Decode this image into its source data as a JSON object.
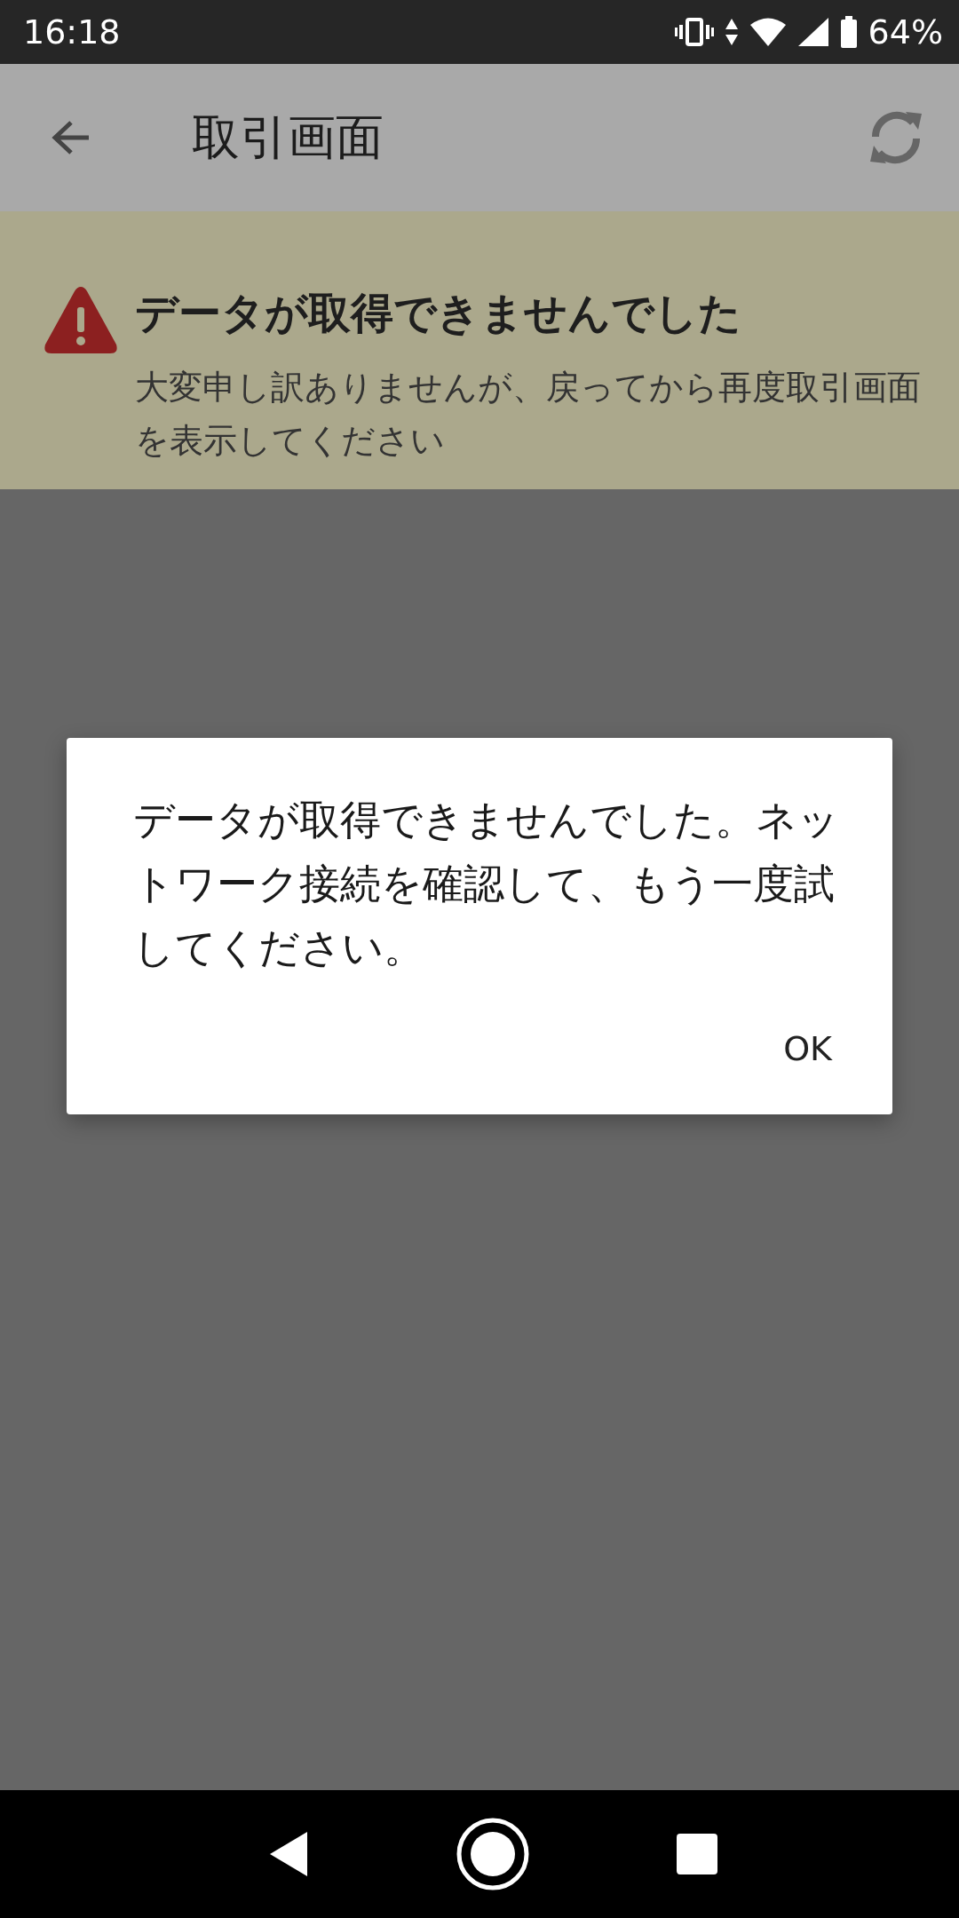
{
  "status_bar": {
    "time": "16:18",
    "battery": "64%"
  },
  "app_bar": {
    "title": "取引画面"
  },
  "banner": {
    "title": "データが取得できませんでした",
    "message": "大変申し訳ありませんが、戻ってから再度取引画面を表示してください"
  },
  "dialog": {
    "message": "データが取得できませんでした。ネットワーク接続を確認して、もう一度試してください。",
    "buttons": [
      "OK"
    ]
  }
}
